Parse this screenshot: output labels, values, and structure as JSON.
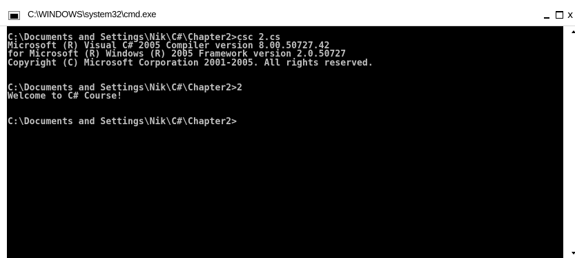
{
  "window": {
    "title": "C:\\WINDOWS\\system32\\cmd.exe",
    "icon": "console-icon",
    "controls": {
      "minimize": "minimize-icon",
      "maximize": "maximize-icon",
      "close": "x"
    }
  },
  "console": {
    "text": "C:\\Documents and Settings\\Nik\\C#\\Chapter2>csc 2.cs\nMicrosoft (R) Visual C# 2005 Compiler version 8.00.50727.42\nfor Microsoft (R) Windows (R) 2005 Framework version 2.0.50727\nCopyright (C) Microsoft Corporation 2001-2005. All rights reserved.\n\n\nC:\\Documents and Settings\\Nik\\C#\\Chapter2>2\nWelcome to C# Course!\n\n\nC:\\Documents and Settings\\Nik\\C#\\Chapter2>",
    "background": "#000000",
    "foreground": "#c0c0c0"
  }
}
